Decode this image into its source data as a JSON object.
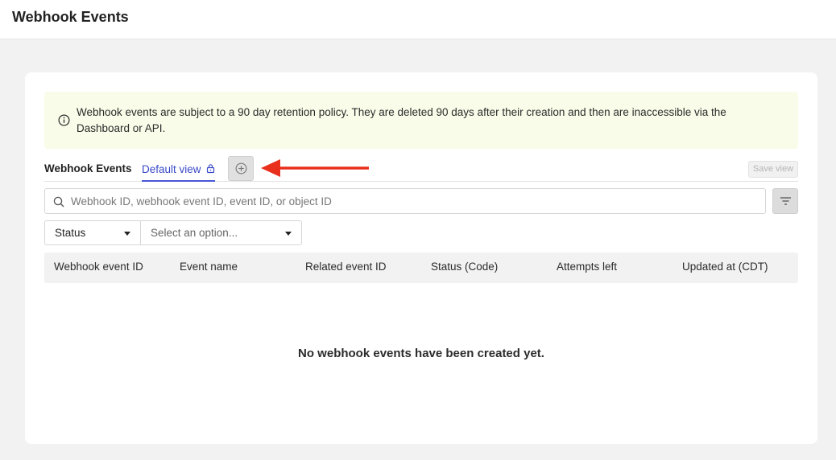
{
  "header": {
    "title": "Webhook Events"
  },
  "notice": {
    "text": "Webhook events are subject to a 90 day retention policy. They are deleted 90 days after their creation and then are inaccessible via the Dashboard or API."
  },
  "tabs": {
    "title": "Webhook Events",
    "default_view": "Default view",
    "save_view": "Save view"
  },
  "search": {
    "placeholder": "Webhook ID, webhook event ID, event ID, or object ID",
    "value": ""
  },
  "filters": {
    "status_label": "Status",
    "option_placeholder": "Select an option..."
  },
  "table": {
    "columns": [
      "Webhook event ID",
      "Event name",
      "Related event ID",
      "Status (Code)",
      "Attempts left",
      "Updated at (CDT)"
    ]
  },
  "empty_state": "No webhook events have been created yet.",
  "colors": {
    "accent": "#3848c8",
    "notice_bg": "#f8fce8",
    "arrow": "#e8301c"
  }
}
